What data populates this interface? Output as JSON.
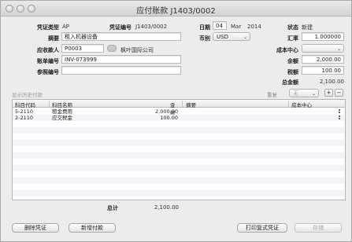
{
  "window": {
    "title": "应付账款 J1403/0002"
  },
  "voucher": {
    "type_label": "凭证类型",
    "type_value": "AP",
    "number_label": "凭证编号",
    "number_value": "J1403/0002",
    "date_label": "日期",
    "date_day": "04",
    "date_month": "Mar",
    "date_year": "2014",
    "status_label": "状态",
    "status_value": "新建"
  },
  "form": {
    "summary_label": "摘要",
    "summary_value": "租入机器设备",
    "payee_label": "应收款人",
    "payee_code": "P0003",
    "payee_name": "枫叶国际公司",
    "account_no_label": "账单编号",
    "account_no_value": "INV-073999",
    "ref_no_label": "参照编号",
    "ref_no_value": "",
    "currency_label": "币别",
    "currency_value": "USD",
    "rate_label": "汇率",
    "rate_value": "1.000000",
    "cost_center_label": "成本中心",
    "cost_center_value": "",
    "balance_label": "余额",
    "balance_value": "2,000.00",
    "tax_label": "税额",
    "tax_value": "100.00",
    "total_label": "总金额",
    "total_value": "2,100.00"
  },
  "toolbar": {
    "show_history_label": "显示历史付款",
    "repeat_label": "重复",
    "none_label": "无",
    "add_label": "+",
    "remove_label": "−"
  },
  "table": {
    "columns": [
      "科目代码",
      "科目名称",
      "金额",
      "摘要",
      "成本中心"
    ],
    "rows": [
      {
        "code": "5-2110",
        "name": "租金费用",
        "amount": "2,000.00",
        "memo": "",
        "cost_center": ""
      },
      {
        "code": "2-2110",
        "name": "应交税金",
        "amount": "100.00",
        "memo": "",
        "cost_center": ""
      }
    ]
  },
  "footer": {
    "total_label": "总计",
    "total_value": "2,100.00",
    "delete_label": "删除凭证",
    "new_payment_label": "新增付款",
    "print_label": "打印复式凭证",
    "save_label": "存储"
  }
}
